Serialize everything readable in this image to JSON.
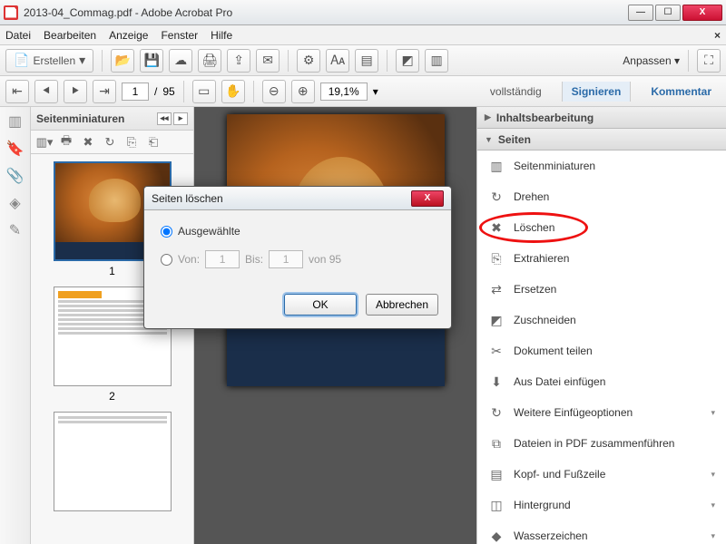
{
  "window": {
    "title": "2013-04_Commag.pdf - Adobe Acrobat Pro"
  },
  "win_controls": {
    "min": "—",
    "max": "☐",
    "close": "X"
  },
  "menu": {
    "datei": "Datei",
    "bearbeiten": "Bearbeiten",
    "anzeige": "Anzeige",
    "fenster": "Fenster",
    "hilfe": "Hilfe"
  },
  "toolbar1": {
    "erstellen": "Erstellen",
    "anpassen": "Anpassen"
  },
  "toolbar2": {
    "page_current": "1",
    "page_sep": "/",
    "page_total": "95",
    "zoom": "19,1%",
    "vollstaendig": "vollständig",
    "signieren": "Signieren",
    "kommentar": "Kommentar"
  },
  "thumb": {
    "title": "Seitenminiaturen",
    "p1": "1",
    "p2": "2"
  },
  "right": {
    "section1": "Inhaltsbearbeitung",
    "section2": "Seiten",
    "tools": {
      "seitenminiaturen": "Seitenminiaturen",
      "drehen": "Drehen",
      "loeschen": "Löschen",
      "extrahieren": "Extrahieren",
      "ersetzen": "Ersetzen",
      "zuschneiden": "Zuschneiden",
      "dokument_teilen": "Dokument teilen",
      "aus_datei": "Aus Datei einfügen",
      "weitere_einfuege": "Weitere Einfügeoptionen",
      "dateien_pdf": "Dateien in PDF zusammenführen",
      "kopf_fuss": "Kopf- und Fußzeile",
      "hintergrund": "Hintergrund",
      "wasserzeichen": "Wasserzeichen"
    }
  },
  "dialog": {
    "title": "Seiten löschen",
    "opt_selected": "Ausgewählte",
    "opt_von": "Von:",
    "von_val": "1",
    "bis_label": "Bis:",
    "bis_val": "1",
    "von_total": "von 95",
    "ok": "OK",
    "cancel": "Abbrechen"
  }
}
